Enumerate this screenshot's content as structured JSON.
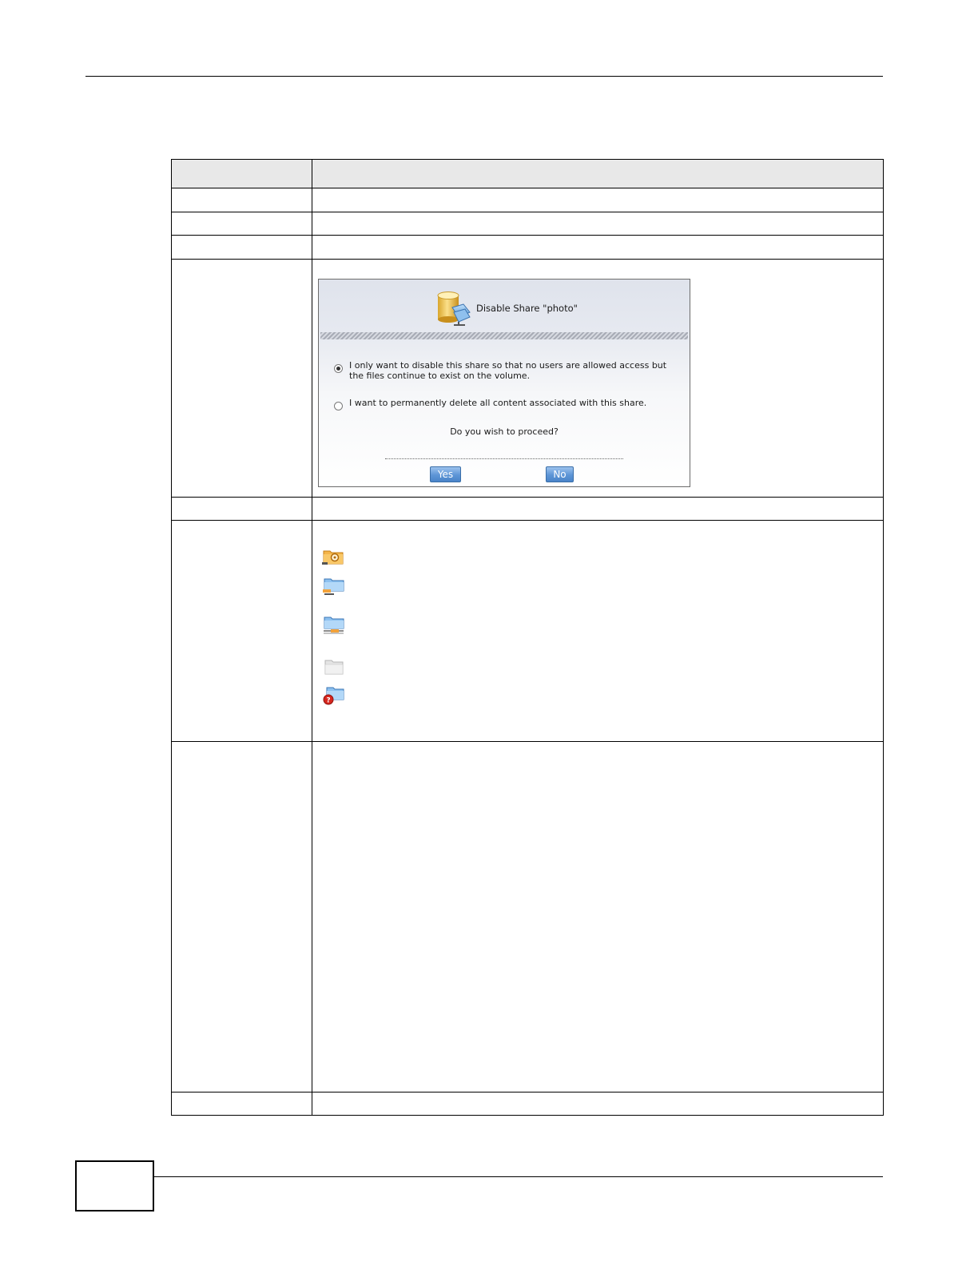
{
  "dialog": {
    "title": "Disable Share \"photo\"",
    "option1": {
      "line1": "I only want to disable this share so that no users are allowed access but",
      "line2": "the files continue to exist on the volume.",
      "selected": true
    },
    "option2": {
      "text": "I want to permanently delete all content associated with this share.",
      "selected": false
    },
    "question": "Do you wish to proceed?",
    "yes_label": "Yes",
    "no_label": "No"
  },
  "legend_icons": [
    "folder-settings-icon",
    "folder-share-icon",
    "folder-network-icon",
    "folder-plain-icon",
    "folder-unknown-icon"
  ]
}
